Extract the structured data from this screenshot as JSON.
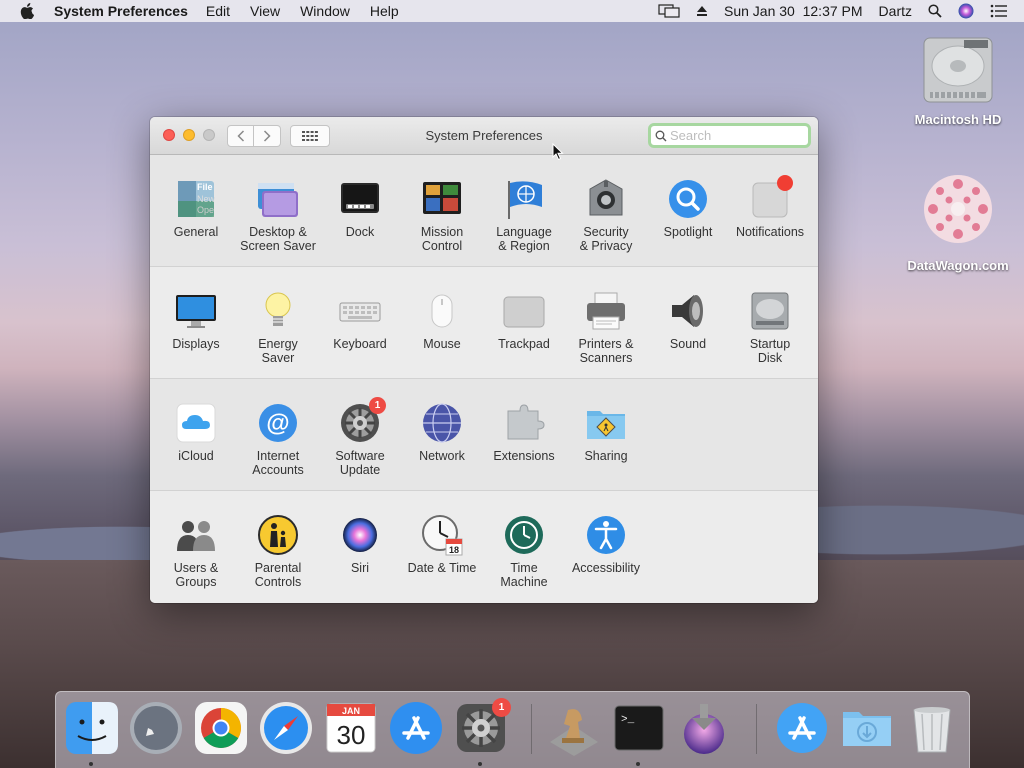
{
  "menubar": {
    "app_name": "System Preferences",
    "menus": [
      "Edit",
      "View",
      "Window",
      "Help"
    ],
    "datetime": "Sun Jan 30  12:37 PM",
    "user": "Dartz"
  },
  "desktop": {
    "icons": [
      {
        "label": "Macintosh HD",
        "icon": "hard-drive-icon"
      },
      {
        "label": "DataWagon.com",
        "icon": "pink-flower-icon"
      }
    ]
  },
  "window": {
    "title": "System Preferences",
    "search": {
      "placeholder": "Search",
      "value": ""
    },
    "sections": [
      [
        {
          "label": "General",
          "icon": "general-icon"
        },
        {
          "label": "Desktop &\nScreen Saver",
          "icon": "desktop-screensaver-icon"
        },
        {
          "label": "Dock",
          "icon": "dock-icon"
        },
        {
          "label": "Mission\nControl",
          "icon": "mission-control-icon"
        },
        {
          "label": "Language\n& Region",
          "icon": "language-region-icon"
        },
        {
          "label": "Security\n& Privacy",
          "icon": "security-privacy-icon"
        },
        {
          "label": "Spotlight",
          "icon": "spotlight-icon"
        },
        {
          "label": "Notifications",
          "icon": "notifications-icon"
        }
      ],
      [
        {
          "label": "Displays",
          "icon": "displays-icon"
        },
        {
          "label": "Energy\nSaver",
          "icon": "energy-saver-icon"
        },
        {
          "label": "Keyboard",
          "icon": "keyboard-icon"
        },
        {
          "label": "Mouse",
          "icon": "mouse-icon"
        },
        {
          "label": "Trackpad",
          "icon": "trackpad-icon"
        },
        {
          "label": "Printers &\nScanners",
          "icon": "printers-scanners-icon"
        },
        {
          "label": "Sound",
          "icon": "sound-icon"
        },
        {
          "label": "Startup\nDisk",
          "icon": "startup-disk-icon"
        }
      ],
      [
        {
          "label": "iCloud",
          "icon": "icloud-icon"
        },
        {
          "label": "Internet\nAccounts",
          "icon": "internet-accounts-icon"
        },
        {
          "label": "Software\nUpdate",
          "icon": "software-update-icon",
          "badge": "1"
        },
        {
          "label": "Network",
          "icon": "network-icon"
        },
        {
          "label": "Extensions",
          "icon": "extensions-icon"
        },
        {
          "label": "Sharing",
          "icon": "sharing-icon"
        }
      ],
      [
        {
          "label": "Users &\nGroups",
          "icon": "users-groups-icon"
        },
        {
          "label": "Parental\nControls",
          "icon": "parental-controls-icon"
        },
        {
          "label": "Siri",
          "icon": "siri-icon"
        },
        {
          "label": "Date & Time",
          "icon": "date-time-icon"
        },
        {
          "label": "Time\nMachine",
          "icon": "time-machine-icon"
        },
        {
          "label": "Accessibility",
          "icon": "accessibility-icon"
        }
      ]
    ]
  },
  "dock": {
    "items": [
      {
        "name": "finder",
        "running": true
      },
      {
        "name": "launchpad",
        "running": false
      },
      {
        "name": "chrome",
        "running": false
      },
      {
        "name": "safari",
        "running": false
      },
      {
        "name": "calendar",
        "running": false,
        "month": "JAN",
        "day": "30"
      },
      {
        "name": "app-store",
        "running": false
      },
      {
        "name": "system-preferences",
        "running": true,
        "badge": "1"
      },
      {
        "name": "chess",
        "running": false
      },
      {
        "name": "terminal",
        "running": true
      },
      {
        "name": "installer",
        "running": false
      },
      {
        "name": "app-store-folder",
        "running": false
      },
      {
        "name": "downloads",
        "running": false
      },
      {
        "name": "trash",
        "running": false
      }
    ]
  }
}
